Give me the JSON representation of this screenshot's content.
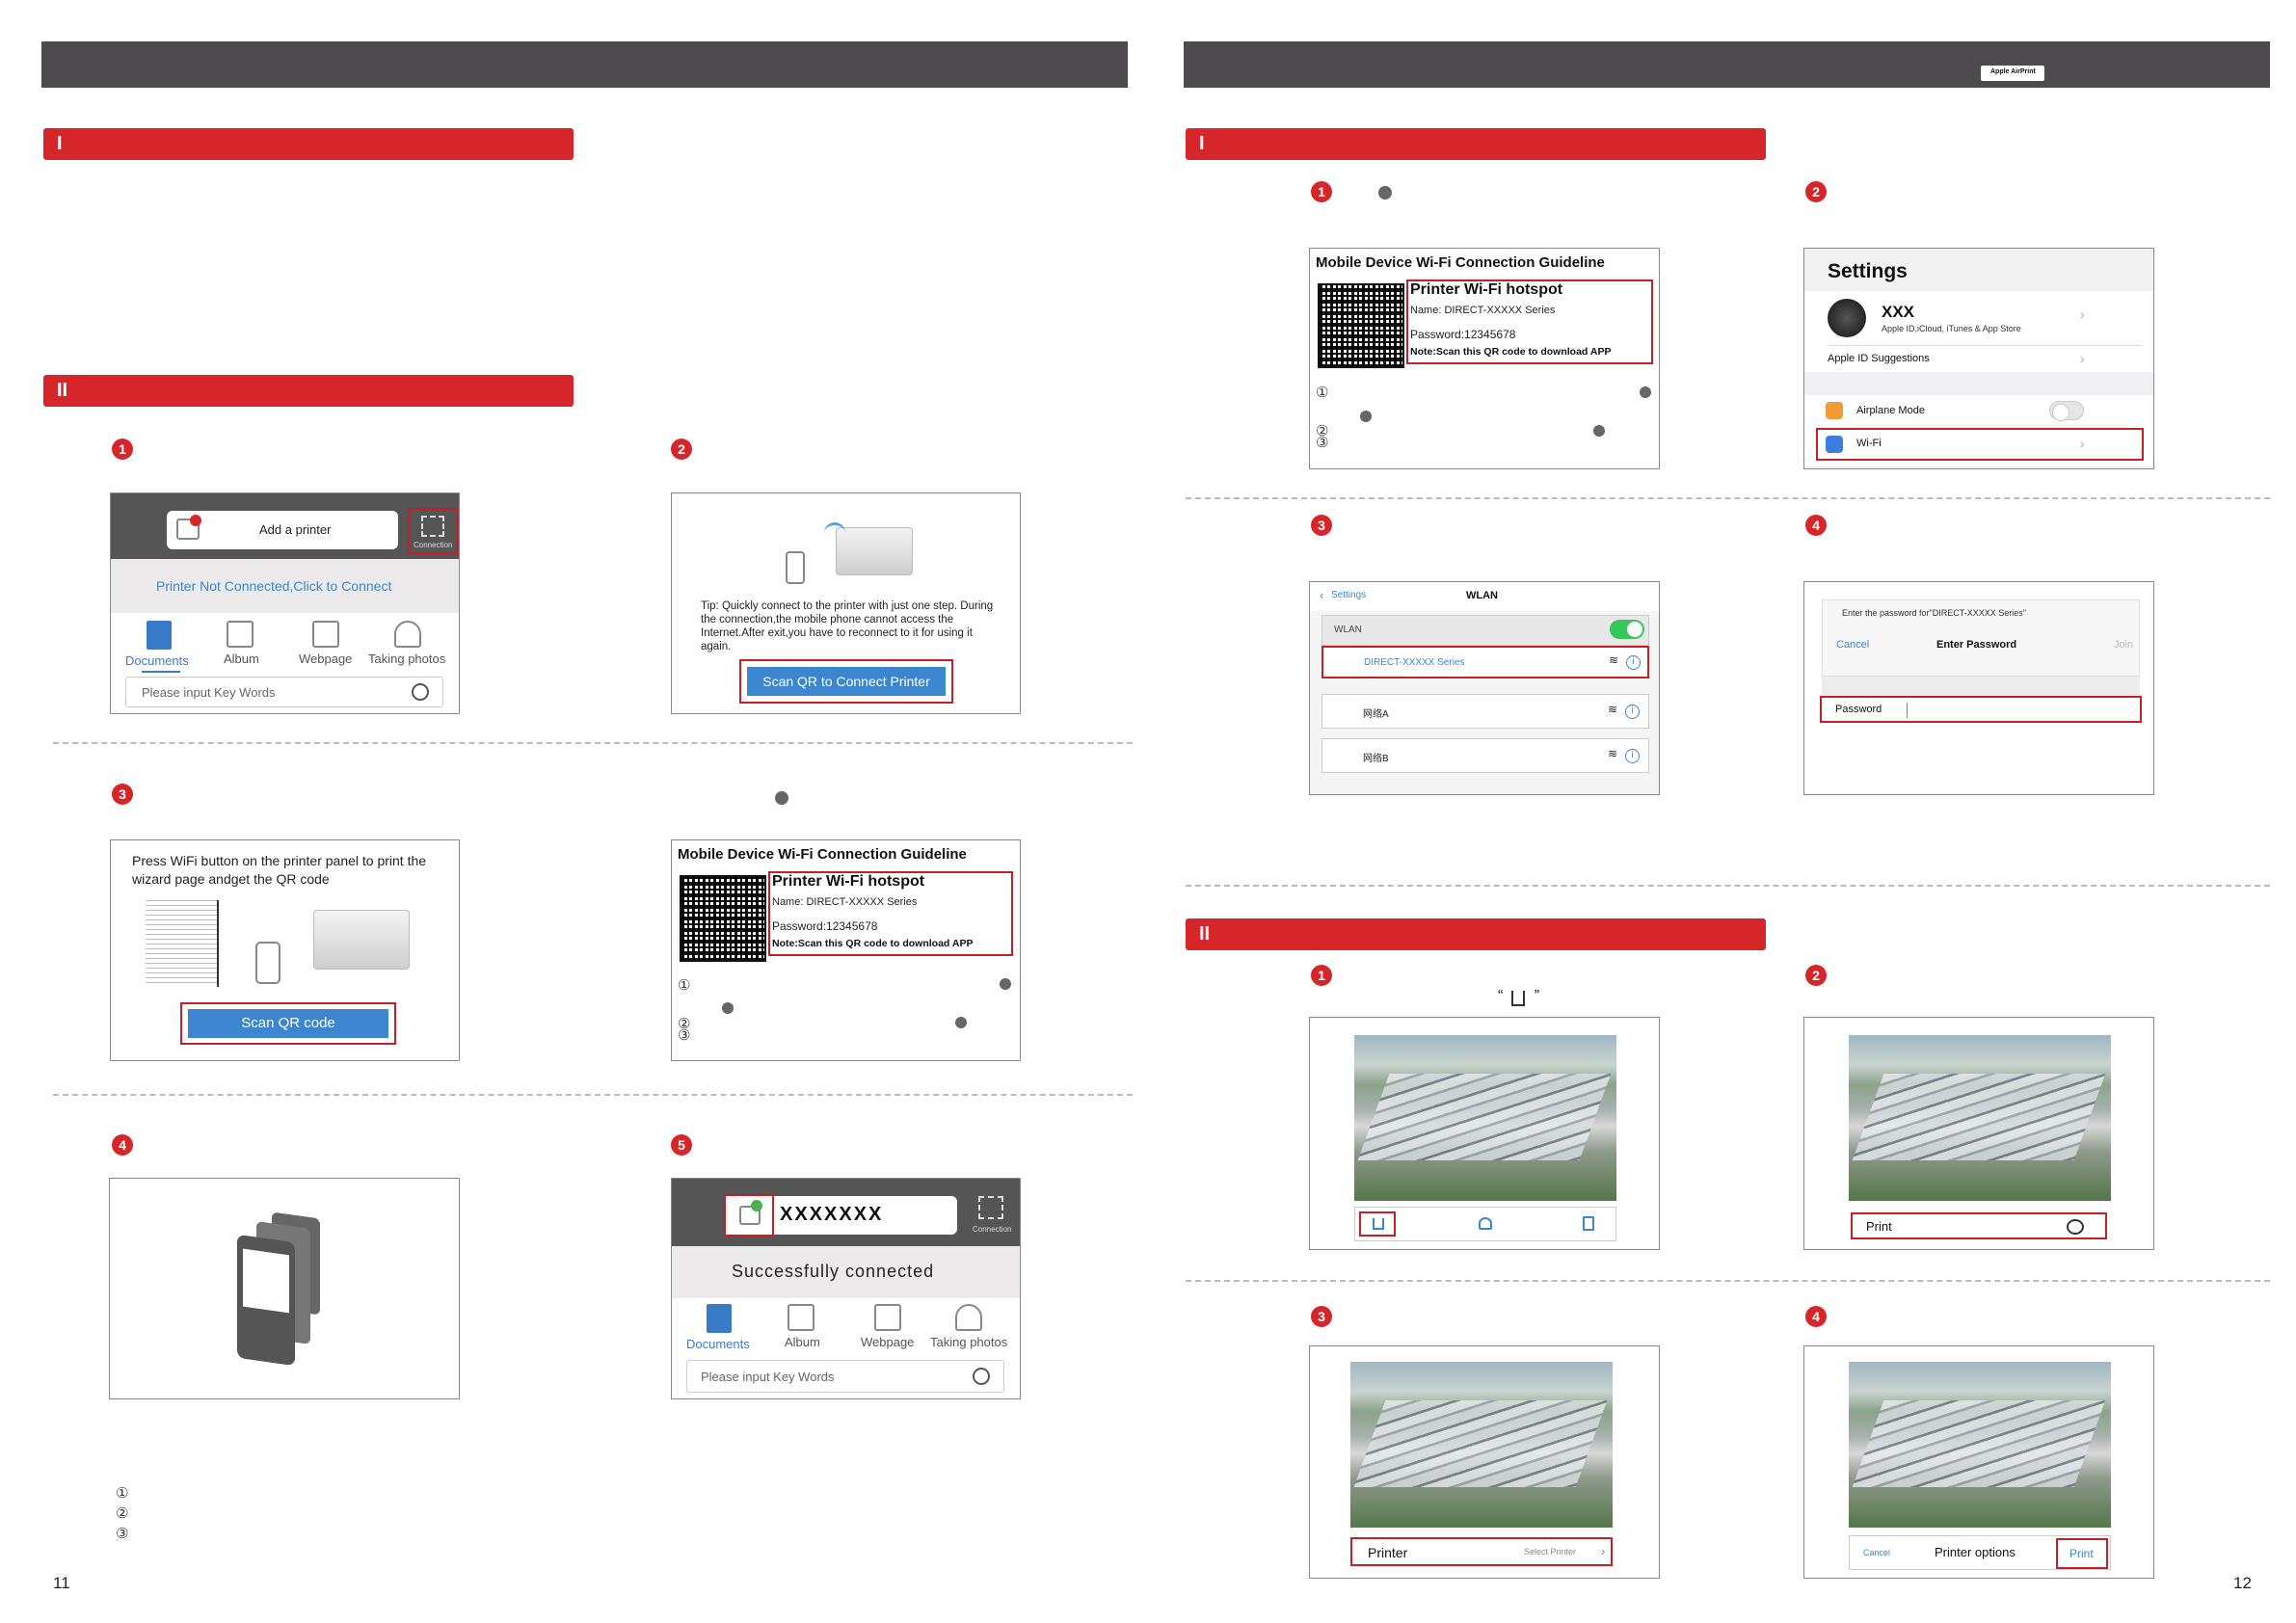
{
  "left_page": {
    "section_1": {
      "label": "I"
    },
    "section_2": {
      "label": "II"
    },
    "step_numbers": [
      "1",
      "2",
      "3",
      "4",
      "5"
    ],
    "screen1": {
      "add_printer": "Add a printer",
      "connection": "Connection",
      "not_connected": "Printer Not Connected,Click  to  Connect",
      "tabs": [
        "Documents",
        "Album",
        "Webpage",
        "Taking photos"
      ],
      "search_placeholder": "Please input Key Words"
    },
    "screen2": {
      "tip": "Tip: Quickly connect to the printer with just one step. During the connection,the mobile phone cannot access the Internet.After exit,you have to reconnect to it for using it again.",
      "button": "Scan QR to Connect Printer"
    },
    "screen3": {
      "instruction": "Press WiFi button on the printer panel to print the wizard page andget the QR code",
      "button": "Scan QR code"
    },
    "guide": {
      "title": "Mobile Device Wi-Fi Connection Guideline",
      "hotspot": "Printer Wi-Fi hotspot",
      "name": "Name: DIRECT-XXXXX Series",
      "password": "Password:12345678",
      "note": "Note:Scan this QR code to download APP",
      "markers": [
        "①",
        "②",
        "③"
      ]
    },
    "screen5": {
      "name": "XXXXXXX",
      "connection": "Connection",
      "status": "Successfully  connected",
      "tabs": [
        "Documents",
        "Album",
        "Webpage",
        "Taking photos"
      ],
      "search_placeholder": "Please input Key Words"
    },
    "footnotes": [
      "①",
      "②",
      "③"
    ],
    "page_number": "11"
  },
  "right_page": {
    "badge": "Apple AirPrint",
    "section_1": {
      "label": "I"
    },
    "section_2": {
      "label": "II"
    },
    "step_numbers": [
      "1",
      "2",
      "3",
      "4"
    ],
    "share_symbol": "“ ”",
    "guide": {
      "title": "Mobile Device Wi-Fi Connection Guideline",
      "hotspot": "Printer Wi-Fi hotspot",
      "name": "Name: DIRECT-XXXXX Series",
      "password": "Password:12345678",
      "note": "Note:Scan this QR code to download APP",
      "markers": [
        "①",
        "②",
        "③"
      ]
    },
    "settings": {
      "title": "Settings",
      "user": "XXX",
      "user_sub": "Apple ID,iCloud, iTunes & App Store",
      "suggestions": "Apple ID Suggestions",
      "airplane": "Airplane Mode",
      "wifi": "Wi-Fi",
      "chevron": "›"
    },
    "wlan": {
      "back": "Settings",
      "title": "WLAN",
      "row": "WLAN",
      "networks": [
        "DIRECT-XXXXX Series",
        "网络A",
        "网络B"
      ],
      "back_chevron": "‹"
    },
    "password_dialog": {
      "prompt": "Enter the password for\"DIRECT-XXXXX Series\"",
      "cancel": "Cancel",
      "title": "Enter Password",
      "join": "Join",
      "field": "Password"
    },
    "print_screens": {
      "print": "Print",
      "printer": "Printer",
      "select_printer": "Select  Printer",
      "cancel": "Cancel",
      "options": "Printer options",
      "print_btn": "Print"
    },
    "page_number": "12"
  }
}
